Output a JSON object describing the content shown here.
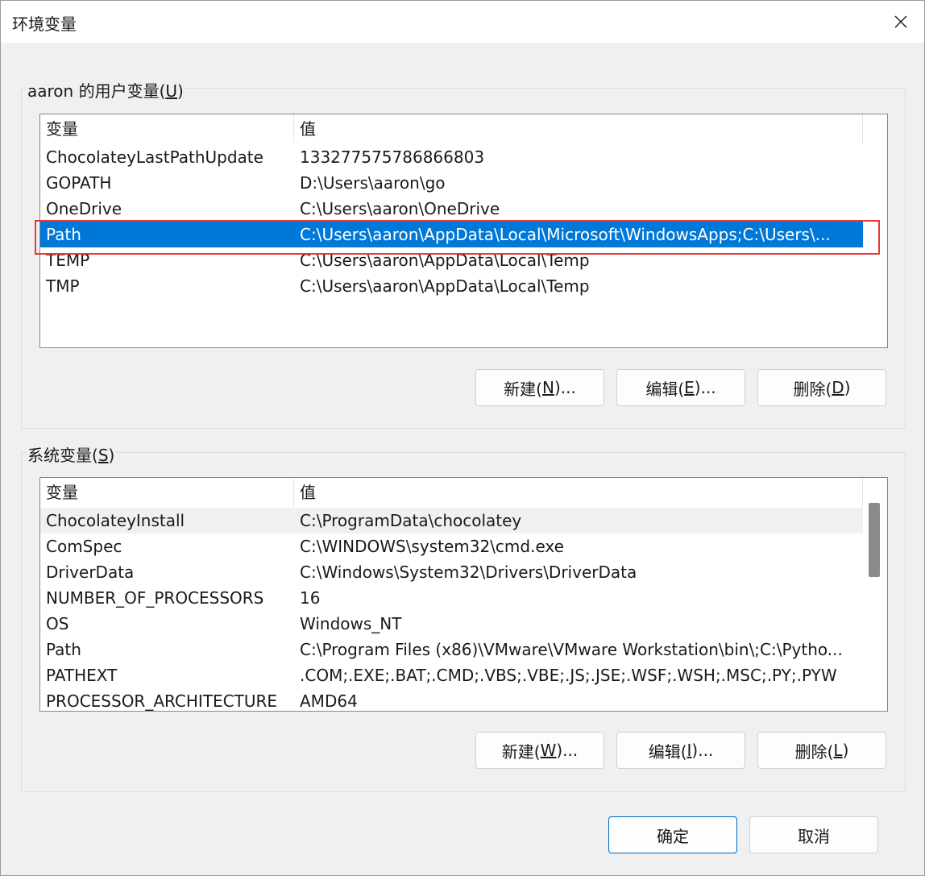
{
  "window": {
    "title": "环境变量"
  },
  "user_group": {
    "label_prefix": "aaron 的用户变量(",
    "label_key": "U",
    "label_suffix": ")",
    "columns": [
      "变量",
      "值"
    ],
    "rows": [
      {
        "name": "ChocolateyLastPathUpdate",
        "value": "133277575786866803"
      },
      {
        "name": "GOPATH",
        "value": "D:\\Users\\aaron\\go"
      },
      {
        "name": "OneDrive",
        "value": "C:\\Users\\aaron\\OneDrive"
      },
      {
        "name": "Path",
        "value": "C:\\Users\\aaron\\AppData\\Local\\Microsoft\\WindowsApps;C:\\Users\\..."
      },
      {
        "name": "TEMP",
        "value": "C:\\Users\\aaron\\AppData\\Local\\Temp"
      },
      {
        "name": "TMP",
        "value": "C:\\Users\\aaron\\AppData\\Local\\Temp"
      }
    ],
    "selected_index": 3,
    "buttons": {
      "new": {
        "pre": "新建(",
        "key": "N",
        "post": ")..."
      },
      "edit": {
        "pre": "编辑(",
        "key": "E",
        "post": ")..."
      },
      "delete": {
        "pre": "删除(",
        "key": "D",
        "post": ")"
      }
    }
  },
  "system_group": {
    "label_prefix": "系统变量(",
    "label_key": "S",
    "label_suffix": ")",
    "columns": [
      "变量",
      "值"
    ],
    "rows": [
      {
        "name": "ChocolateyInstall",
        "value": "C:\\ProgramData\\chocolatey"
      },
      {
        "name": "ComSpec",
        "value": "C:\\WINDOWS\\system32\\cmd.exe"
      },
      {
        "name": "DriverData",
        "value": "C:\\Windows\\System32\\Drivers\\DriverData"
      },
      {
        "name": "NUMBER_OF_PROCESSORS",
        "value": "16"
      },
      {
        "name": "OS",
        "value": "Windows_NT"
      },
      {
        "name": "Path",
        "value": "C:\\Program Files (x86)\\VMware\\VMware Workstation\\bin\\;C:\\Pytho..."
      },
      {
        "name": "PATHEXT",
        "value": ".COM;.EXE;.BAT;.CMD;.VBS;.VBE;.JS;.JSE;.WSF;.WSH;.MSC;.PY;.PYW"
      },
      {
        "name": "PROCESSOR_ARCHITECTURE",
        "value": "AMD64"
      }
    ],
    "hover_index": 0,
    "buttons": {
      "new": {
        "pre": "新建(",
        "key": "W",
        "post": ")..."
      },
      "edit": {
        "pre": "编辑(",
        "key": "I",
        "post": ")..."
      },
      "delete": {
        "pre": "删除(",
        "key": "L",
        "post": ")"
      }
    }
  },
  "footer": {
    "ok": "确定",
    "cancel": "取消"
  },
  "icons": {
    "close": "close-icon"
  },
  "colors": {
    "selection": "#0078d7",
    "highlight_box": "#e53935"
  }
}
